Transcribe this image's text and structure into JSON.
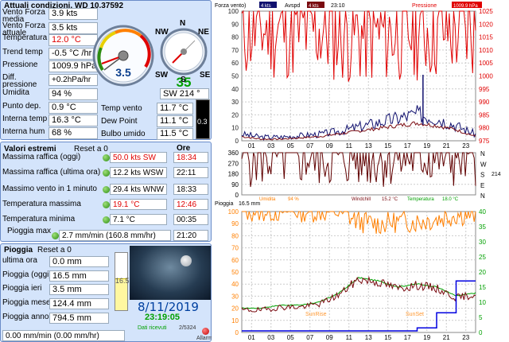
{
  "current": {
    "title": "Attuali condizioni, WD 10.37592",
    "rows": [
      {
        "label": "Vento Forza media",
        "value": "3.9 kts"
      },
      {
        "label": "Vento Forza attuale",
        "value": "3.5 kts"
      },
      {
        "label": "Temperatura",
        "value": "12.0 °C"
      },
      {
        "label": "Trend temp",
        "value": "-0.5 °C /hr"
      },
      {
        "label": "Pressione",
        "value": "1009.9 hPa"
      },
      {
        "label": "Diff. pressione",
        "value": "+0.2hPa/hr"
      },
      {
        "label": "Umidita",
        "value": "94 %"
      },
      {
        "label": "Punto dep.",
        "value": "0.9 °C"
      },
      {
        "label": "Interna temp",
        "value": "16.3 °C"
      },
      {
        "label": "Interna hum",
        "value": "68 %"
      }
    ],
    "gauge_speed": "3.5",
    "compass_big": "35",
    "compass": {
      "N": "N",
      "NE": "NE",
      "NW": "NW",
      "SE": "SE",
      "SW": "SW",
      "S": "S"
    },
    "dir_value": "SW 214 °",
    "temp_vento_label": "Temp vento",
    "temp_vento": "11.7 °C",
    "dew_label": "Dew Point",
    "dew": "11.1 °C",
    "bulbo_label": "Bulbo umido",
    "bulbo": "11.5 °C",
    "bar_value": "0.3"
  },
  "extremes": {
    "title": "Valori estremi",
    "reset": "Reset a 0",
    "ore": "Ore",
    "rows": [
      {
        "label": "Massima raffica (oggi)",
        "value": "50.0 kts  SW",
        "time": "18:34",
        "alert": true
      },
      {
        "label": "Massima raffica (ultima ora)",
        "value": "12.2 kts WSW",
        "time": "22:11",
        "alert": false
      },
      {
        "label": "Massimo vento in 1 minuto",
        "value": "29.4 kts WNW",
        "time": "18:33",
        "alert": false
      },
      {
        "label": "Temperatura massima",
        "value": "19.1 °C",
        "time": "12:46",
        "alert": true
      },
      {
        "label": "Temperatura minima",
        "value": "7.1 °C",
        "time": "00:35",
        "alert": false
      },
      {
        "label": "Pioggia max",
        "value": "2.7 mm/min (160.8 mm/hr)",
        "time": "21:20",
        "alert": false
      }
    ]
  },
  "rain": {
    "title": "Pioggia",
    "reset": "Reset a 0",
    "rows": [
      {
        "label": "ultima ora",
        "value": "0.0 mm"
      },
      {
        "label": "Pioggia (oggi)",
        "value": "16.5 mm"
      },
      {
        "label": "Pioggia ieri",
        "value": "3.5 mm"
      },
      {
        "label": "Pioggia mese",
        "value": "124.4 mm"
      },
      {
        "label": "Pioggia anno",
        "value": "794.5 mm"
      }
    ],
    "rate": "0.00 mm/min (0.00 mm/hr)",
    "gauge_label": "16.5",
    "gauge_level": 0.55
  },
  "clock": {
    "date": "8/11/2019",
    "time": "23:19:05",
    "dati": "Dati ricevuti",
    "count": "2/5324",
    "alarm": "Allarmi"
  },
  "chart1": {
    "legend_a": "Forza vento)",
    "legend_a_val": "4 kts",
    "legend_b": "Avspd",
    "legend_b_val": "4 kts",
    "legend_time": "23:10",
    "legend_c": "Pressione",
    "legend_c_val": "1009.9 hPa",
    "left_ticks": [
      "100",
      "90",
      "80",
      "70",
      "60",
      "50",
      "40",
      "30",
      "20",
      "10",
      "0"
    ],
    "right_ticks": [
      "1025",
      "1020",
      "1015",
      "1010",
      "1005",
      "1000",
      "995",
      "990",
      "985",
      "980",
      "975"
    ],
    "x_ticks": [
      "01",
      "03",
      "05",
      "07",
      "09",
      "11",
      "13",
      "15",
      "17",
      "19",
      "21",
      "23"
    ]
  },
  "chart2": {
    "left_ticks": [
      "360",
      "270",
      "180",
      "90",
      "0"
    ],
    "right_letters": [
      "N",
      "W",
      "S",
      "E",
      "N"
    ],
    "side_value": "214",
    "legend": [
      {
        "label": "Umidita",
        "value": "94 %"
      },
      {
        "label": "Windchill",
        "value": "15.2 °C"
      },
      {
        "label": "Temperatura",
        "value": "18.0 °C"
      }
    ]
  },
  "chart3": {
    "legend": "Pioggia",
    "legend_val": "16.5 mm",
    "left_ticks": [
      "100",
      "90",
      "80",
      "70",
      "60",
      "50",
      "40",
      "30",
      "20",
      "10",
      "0"
    ],
    "right_ticks": [
      "40",
      "35",
      "30",
      "25",
      "20",
      "15",
      "10",
      "5",
      "0"
    ],
    "x_ticks": [
      "01",
      "03",
      "05",
      "07",
      "09",
      "11",
      "13",
      "15",
      "17",
      "19",
      "21",
      "23"
    ],
    "sunrise": "SunRise",
    "sunset": "SunSet"
  },
  "chart_data": [
    {
      "type": "line",
      "title": "",
      "x": [
        0,
        2,
        4,
        6,
        8,
        10,
        12,
        14,
        16,
        18,
        20,
        22,
        24
      ],
      "series": [
        {
          "name": "Forza vento",
          "color": "#10106e",
          "values": [
            4,
            2,
            2,
            3,
            4,
            6,
            9,
            12,
            15,
            18,
            15,
            10,
            4
          ]
        },
        {
          "name": "Avspd",
          "color": "#7a0a10",
          "values": [
            3,
            1,
            1,
            2,
            3,
            5,
            7,
            9,
            11,
            13,
            11,
            8,
            3
          ]
        },
        {
          "name": "Pressione",
          "color": "#e00000",
          "values": [
            1010,
            1010,
            1010,
            1010,
            1010,
            1009,
            1008,
            1008,
            1009,
            1010,
            1010,
            1010,
            1010
          ]
        }
      ],
      "ylim": [
        0,
        100
      ],
      "y2lim": [
        975,
        1025
      ]
    },
    {
      "type": "line",
      "x": [
        0,
        4,
        8,
        12,
        16,
        20,
        24
      ],
      "series": [
        {
          "name": "Direzione",
          "color": "#600000",
          "values": [
            240,
            230,
            225,
            230,
            225,
            240,
            214
          ]
        }
      ],
      "ylim": [
        0,
        360
      ]
    },
    {
      "type": "line",
      "x": [
        0,
        2,
        4,
        6,
        8,
        10,
        12,
        14,
        16,
        18,
        20,
        22,
        24
      ],
      "series": [
        {
          "name": "Umidita",
          "color": "#ff7f00",
          "values": [
            97,
            97,
            97,
            97,
            97,
            96,
            88,
            86,
            88,
            88,
            90,
            94,
            94
          ]
        },
        {
          "name": "Temperatura",
          "color": "#00a000",
          "values": [
            8,
            8,
            9,
            9,
            10,
            13,
            18,
            17,
            15,
            16,
            15,
            12,
            13
          ]
        },
        {
          "name": "Windchill",
          "color": "#7a0a10",
          "values": [
            7,
            7,
            8,
            8,
            9,
            12,
            17,
            16,
            14,
            15,
            14,
            11,
            12
          ]
        },
        {
          "name": "Pioggia",
          "color": "#0000e0",
          "values": [
            0,
            0,
            0,
            0,
            0,
            0,
            0,
            0,
            0,
            1,
            6,
            16.5,
            16.5
          ]
        }
      ],
      "ylim": [
        0,
        100
      ],
      "y2lim": [
        0,
        40
      ]
    }
  ]
}
